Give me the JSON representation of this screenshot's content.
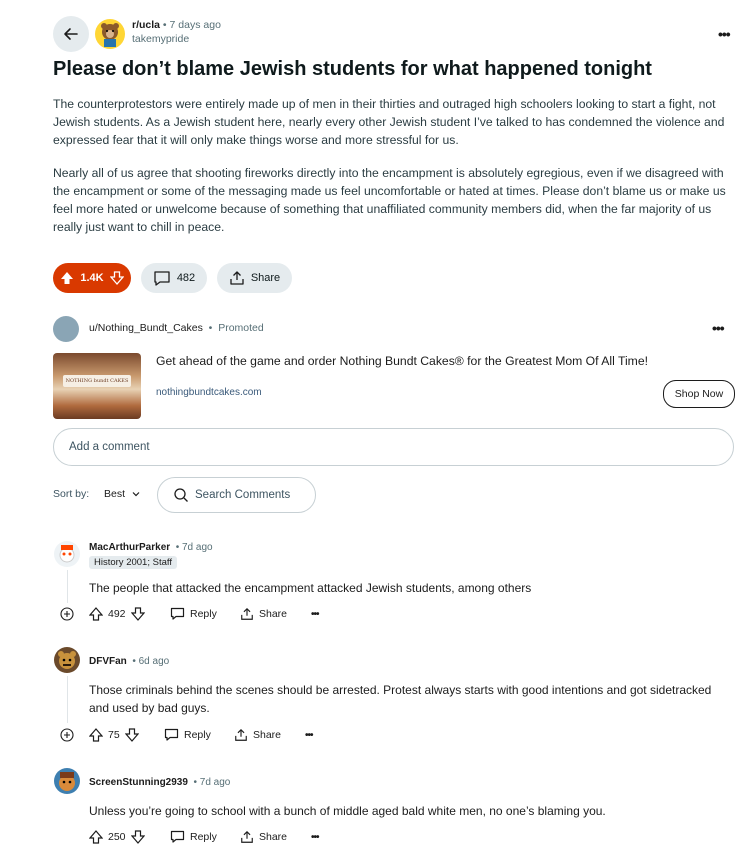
{
  "post": {
    "subreddit": "r/ucla",
    "time": "7 days ago",
    "author": "takemypride",
    "title": "Please don’t blame Jewish students for what happened tonight",
    "paragraphs": [
      "The counterprotestors were entirely made up of men in their thirties and outraged high schoolers looking to start a fight, not Jewish students. As a Jewish student here, nearly every other Jewish student I’ve talked to has condemned the violence and expressed fear that it will only make things worse and more stressful for us.",
      "Nearly all of us agree that shooting fireworks directly into the encampment is absolutely egregious, even if we disagreed with the encampment or some of the messaging made us feel uncomfortable or hated at times. Please don’t blame us or make us feel more hated or unwelcome because of something that unaffiliated community members did, when the far majority of us really just want to chill in peace."
    ],
    "votes": "1.4K",
    "comments": "482",
    "share_label": "Share"
  },
  "promo": {
    "user": "u/Nothing_Bundt_Cakes",
    "tag": "Promoted",
    "text": "Get ahead of the game and order Nothing Bundt Cakes® for the Greatest Mom Of All Time!",
    "link": "nothingbundtcakes.com",
    "cta": "Shop Now",
    "img_brand": "NOTHING bundt CAKES"
  },
  "comment_box": {
    "placeholder": "Add a comment"
  },
  "sort": {
    "label": "Sort by:",
    "value": "Best"
  },
  "search": {
    "placeholder": "Search Comments"
  },
  "comments": [
    {
      "user": "MacArthurParker",
      "time": "7d ago",
      "flair": "History 2001; Staff",
      "text": "The people that attacked the encampment attacked Jewish students, among others",
      "votes": "492",
      "reply": "Reply",
      "share": "Share"
    },
    {
      "user": "DFVFan",
      "time": "6d ago",
      "text": "Those criminals behind the scenes should be arrested. Protest always starts with good intentions and got sidetracked and used by bad guys.",
      "votes": "75",
      "reply": "Reply",
      "share": "Share"
    },
    {
      "user": "ScreenStunning2939",
      "time": "7d ago",
      "text": "Unless you’re going to school with a bunch of middle aged bald white men, no one’s blaming you.",
      "votes": "250",
      "reply": "Reply",
      "share": "Share"
    }
  ],
  "colors": {
    "upvote_accent": "#d93900",
    "pill_bg": "#e5ebee"
  },
  "icons": [
    "back-arrow-icon",
    "more-icon",
    "upvote-icon",
    "downvote-icon",
    "comment-icon",
    "share-icon",
    "search-icon",
    "chevron-down-icon",
    "expand-icon"
  ]
}
